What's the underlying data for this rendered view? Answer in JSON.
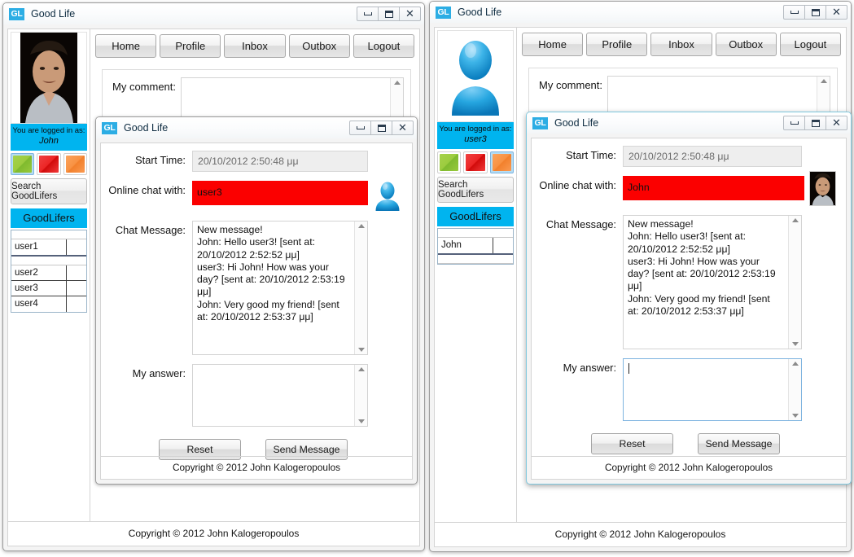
{
  "app": {
    "window_title": "Good Life",
    "logo_text": "GL",
    "footer": "Copyright © 2012 John Kalogeropoulos",
    "nav": [
      {
        "label": "Home"
      },
      {
        "label": "Profile"
      },
      {
        "label": "Inbox"
      },
      {
        "label": "Outbox"
      },
      {
        "label": "Logout"
      }
    ],
    "comment_label": "My comment:",
    "comment_value": "",
    "sidebar": {
      "logged_in_label": "You are logged in as:",
      "search_button": "Search GoodLifers",
      "list_header": "GoodLifers"
    }
  },
  "left_window": {
    "title": "Good Life",
    "user": "John",
    "avatar_type": "photo-john",
    "status_selected_index": 0,
    "status_buttons": [
      {
        "name": "available",
        "color": "#9ccc3f"
      },
      {
        "name": "busy",
        "color": "#ec2626"
      },
      {
        "name": "away",
        "color": "#f89243"
      }
    ],
    "user_groups": [
      {
        "rows": [
          {
            "name": "user1",
            "status_color": "#4db4ec"
          }
        ]
      },
      {
        "rows": [
          {
            "name": "user2",
            "status_color": "#9ccc3f"
          },
          {
            "name": "user3",
            "status_color": "#f89243"
          },
          {
            "name": "user4",
            "status_color": "#ec2626"
          }
        ]
      }
    ]
  },
  "right_window": {
    "title": "Good Life",
    "user": "user3",
    "avatar_type": "generic-blue",
    "status_selected_index": 2,
    "status_buttons": [
      {
        "name": "available",
        "color": "#9ccc3f"
      },
      {
        "name": "busy",
        "color": "#ec2626"
      },
      {
        "name": "away",
        "color": "#f89243"
      }
    ],
    "user_groups": [
      {
        "rows": [
          {
            "name": "John",
            "status_color": "#9ccc3f"
          }
        ]
      },
      {
        "rows": []
      }
    ]
  },
  "chat_dialog_left": {
    "title": "Good Life",
    "start_time_label": "Start Time:",
    "start_time_value": "20/10/2012 2:50:48 μμ",
    "online_with_label": "Online chat with:",
    "online_with_value": "user3",
    "partner_avatar": "generic-blue",
    "chat_label": "Chat Message:",
    "chat_transcript": "New message!\nJohn: Hello user3! [sent at: 20/10/2012 2:52:52 μμ]\nuser3: Hi John! How was your day? [sent at: 20/10/2012 2:53:19 μμ]\nJohn: Very good my friend! [sent at: 20/10/2012 2:53:37 μμ]",
    "answer_label": "My answer:",
    "answer_value": "",
    "answer_focused": false,
    "reset_button": "Reset",
    "send_button": "Send Message",
    "footer": "Copyright © 2012 John Kalogeropoulos"
  },
  "chat_dialog_right": {
    "title": "Good Life",
    "start_time_label": "Start Time:",
    "start_time_value": "20/10/2012 2:50:48 μμ",
    "online_with_label": "Online chat with:",
    "online_with_value": "John",
    "partner_avatar": "photo-john",
    "chat_label": "Chat Message:",
    "chat_transcript": "New message!\nJohn: Hello user3! [sent at: 20/10/2012 2:52:52 μμ]\nuser3: Hi John! How was your day? [sent at: 20/10/2012 2:53:19 μμ]\nJohn: Very good my friend! [sent at: 20/10/2012 2:53:37 μμ]",
    "answer_label": "My answer:",
    "answer_value": "",
    "answer_focused": true,
    "reset_button": "Reset",
    "send_button": "Send Message",
    "footer": "Copyright © 2012 John Kalogeropoulos"
  },
  "window_controls": {
    "minimize": "minimize",
    "maximize": "maximize",
    "close": "✕"
  },
  "colors": {
    "accent_blue": "#00b4ef",
    "logo_blue": "#2cade4",
    "alert_red": "#fb0000"
  }
}
